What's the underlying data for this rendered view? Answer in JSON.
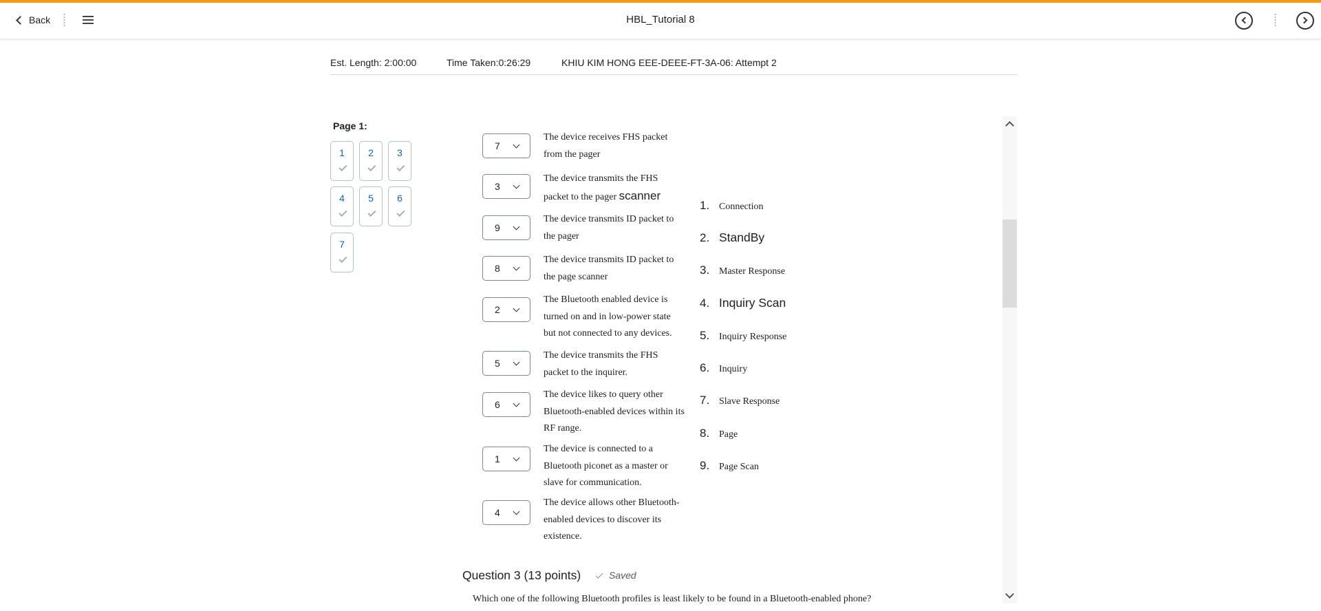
{
  "header": {
    "back_label": "Back",
    "title": "HBL_Tutorial 8",
    "accent_color": "#f39c12"
  },
  "info": {
    "est_length": "Est. Length: 2:00:00",
    "time_taken": "Time Taken:0:26:29",
    "attempt": "KHIU KIM HONG EEE-DEEE-FT-3A-06: Attempt 2"
  },
  "pager": {
    "title": "Page 1:",
    "questions": [
      "1",
      "2",
      "3",
      "4",
      "5",
      "6",
      "7"
    ]
  },
  "matching": {
    "rows": [
      {
        "value": "7",
        "text": "The device receives FHS packet from the pager"
      },
      {
        "value": "3",
        "text": "The device transmits the FHS packet to the pager ",
        "text_large": "scanner"
      },
      {
        "value": "9",
        "text": "The device transmits ID packet to the pager"
      },
      {
        "value": "8",
        "text": "The device transmits ID packet to the page scanner"
      },
      {
        "value": "2",
        "text": "The Bluetooth enabled device is turned on and in low-power state but not connected to any devices."
      },
      {
        "value": "5",
        "text": "The device transmits the FHS packet to the inquirer."
      },
      {
        "value": "6",
        "text": "The device likes to query other Bluetooth-enabled devices within its RF range."
      },
      {
        "value": "1",
        "text": "The device is connected to a Bluetooth piconet as a master or slave for communication."
      },
      {
        "value": "4",
        "text": "The device allows other Bluetooth-enabled devices to discover its existence."
      }
    ],
    "choices": [
      {
        "num": "1.",
        "label": "Connection"
      },
      {
        "num": "2.",
        "label": "StandBy"
      },
      {
        "num": "3.",
        "label": "Master Response"
      },
      {
        "num": "4.",
        "label": "Inquiry Scan"
      },
      {
        "num": "5.",
        "label": "Inquiry Response"
      },
      {
        "num": "6.",
        "label": "Inquiry"
      },
      {
        "num": "7.",
        "label": "Slave Response"
      },
      {
        "num": "8.",
        "label": "Page"
      },
      {
        "num": "9.",
        "label": "Page Scan"
      }
    ]
  },
  "question3": {
    "title": "Question 3",
    "points": "(13 points)",
    "status": "Saved",
    "text": "Which one of the following Bluetooth profiles is least likely to be found in a Bluetooth-enabled phone?"
  }
}
